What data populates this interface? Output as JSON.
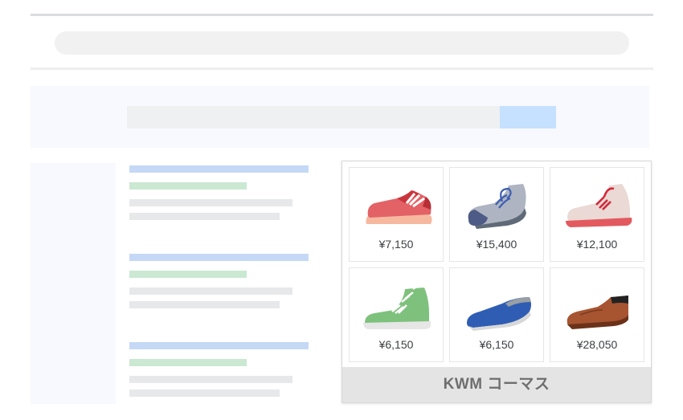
{
  "shopping": {
    "products": [
      {
        "price": "¥7,150",
        "icon": "red-sneaker-icon"
      },
      {
        "price": "¥15,400",
        "icon": "gray-running-shoe-icon"
      },
      {
        "price": "¥12,100",
        "icon": "pink-sneaker-icon"
      },
      {
        "price": "¥6,150",
        "icon": "green-high-top-icon"
      },
      {
        "price": "¥6,150",
        "icon": "blue-loafer-icon"
      },
      {
        "price": "¥28,050",
        "icon": "brown-dress-shoe-icon"
      }
    ],
    "merchant": "KWM コーマス"
  },
  "colors": {
    "title_bar": "#c5d8f6",
    "url_bar": "#cae8d2",
    "text_bar": "#e6e8ea",
    "search_button": "#c6e0ff",
    "page_band": "#f8f9fe"
  }
}
